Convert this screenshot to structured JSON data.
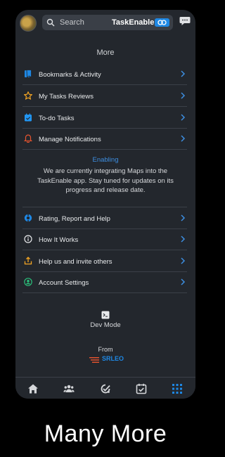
{
  "header": {
    "search_placeholder": "Search",
    "brand": "TaskEnable"
  },
  "page": {
    "title": "More"
  },
  "menu_top": [
    {
      "label": "Bookmarks & Activity",
      "icon": "bookmark-icon",
      "color": "#1e88e5"
    },
    {
      "label": "My Tasks Reviews",
      "icon": "star-icon",
      "color": "#f5a623"
    },
    {
      "label": "To-do Tasks",
      "icon": "calendar-icon",
      "color": "#2196f3"
    },
    {
      "label": "Manage Notifications",
      "icon": "bell-icon",
      "color": "#e8542f"
    }
  ],
  "notice": {
    "heading": "Enabling",
    "text": "We are currently integrating Maps into the TaskEnable app. Stay tuned for updates on its progress and release date."
  },
  "menu_bottom": [
    {
      "label": "Rating, Report and Help",
      "icon": "help-icon",
      "color": "#1e88e5"
    },
    {
      "label": "How It Works",
      "icon": "info-icon",
      "color": "#e8eaec"
    },
    {
      "label": "Help us and invite others",
      "icon": "share-icon",
      "color": "#f5a623"
    },
    {
      "label": "Account Settings",
      "icon": "account-icon",
      "color": "#2bbf7a"
    }
  ],
  "footer": {
    "dev_mode": "Dev Mode",
    "from": "From",
    "company": "SRLEO"
  },
  "tabbar": [
    "home-icon",
    "people-icon",
    "tasks-check-icon",
    "calendar-check-icon",
    "grid-icon"
  ],
  "caption": "Many More",
  "colors": {
    "accent": "#1e88e5",
    "background": "#23272d",
    "chevron": "#3d8ee0"
  }
}
